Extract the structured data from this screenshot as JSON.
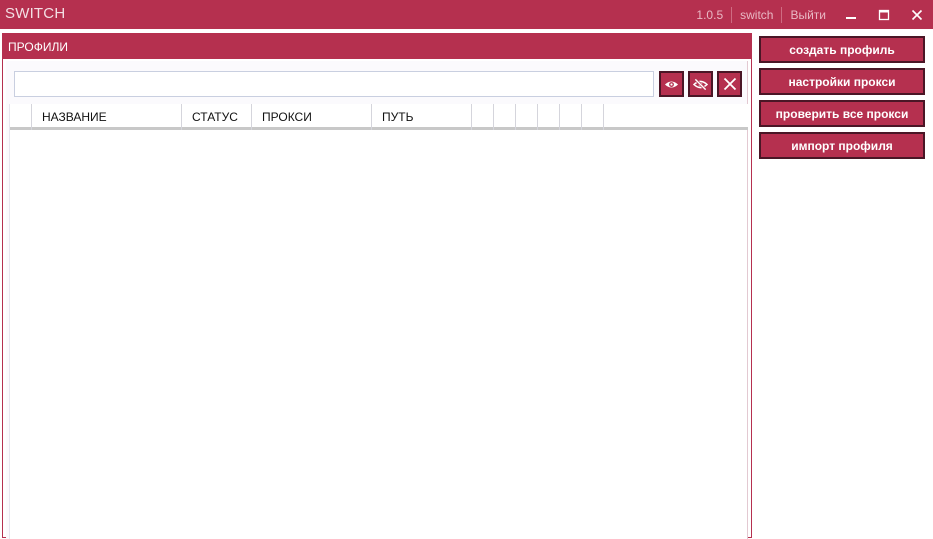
{
  "window": {
    "title": "SWITCH",
    "version": "1.0.5",
    "user": "switch",
    "logout_label": "Выйти"
  },
  "profiles_panel": {
    "title": "ПРОФИЛИ",
    "search": {
      "value": "",
      "placeholder": ""
    },
    "icons": [
      "eye-icon",
      "eye-off-icon",
      "close-icon"
    ]
  },
  "table": {
    "columns": [
      "",
      "НАЗВАНИЕ",
      "СТАТУС",
      "ПРОКСИ",
      "ПУТЬ",
      "",
      "",
      "",
      "",
      "",
      "",
      ""
    ],
    "rows": []
  },
  "actions": {
    "create_profile": "создать профиль",
    "proxy_settings": "настройки прокси",
    "check_all_proxies": "проверить все прокси",
    "import_profile": "импорт профиля"
  },
  "colors": {
    "accent": "#b5304f",
    "button_border": "#4a1626"
  }
}
